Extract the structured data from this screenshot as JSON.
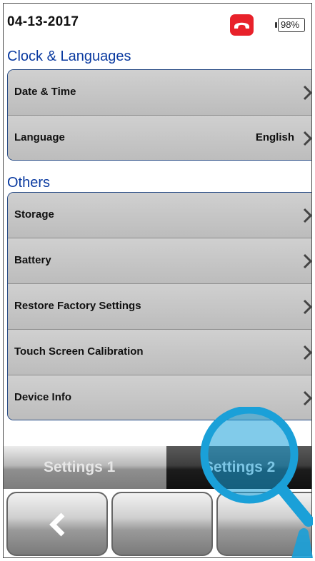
{
  "status": {
    "date": "04-13-2017",
    "battery": "98%",
    "icons": {
      "call": "end-call-icon",
      "battery": "battery-icon"
    },
    "colors": {
      "call_red": "#e8212a"
    }
  },
  "sections": [
    {
      "title": "Clock & Languages",
      "rows": [
        {
          "label": "Date & Time",
          "value": ""
        },
        {
          "label": "Language",
          "value": "English"
        }
      ]
    },
    {
      "title": "Others",
      "rows": [
        {
          "label": "Storage",
          "value": ""
        },
        {
          "label": "Battery",
          "value": ""
        },
        {
          "label": "Restore Factory Settings",
          "value": ""
        },
        {
          "label": "Touch Screen Calibration",
          "value": ""
        },
        {
          "label": "Device Info",
          "value": ""
        }
      ]
    }
  ],
  "tabs": [
    {
      "label": "Settings 1",
      "active": false
    },
    {
      "label": "Settings 2",
      "active": true
    }
  ],
  "bottom_buttons": [
    {
      "icon": "back-chevron-icon"
    },
    {
      "icon": ""
    },
    {
      "icon": ""
    }
  ],
  "overlay": {
    "icon": "magnifier-icon",
    "color": "#1aa0d8"
  }
}
